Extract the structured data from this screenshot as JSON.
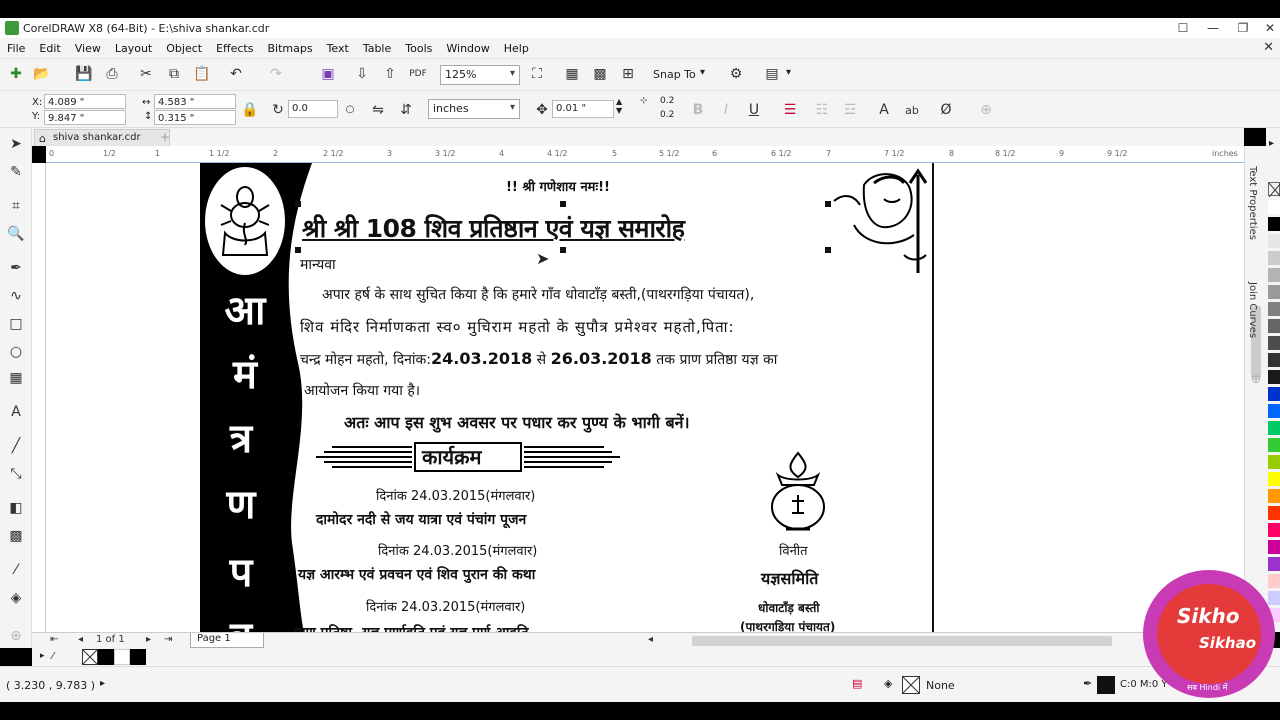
{
  "window": {
    "title": "CorelDRAW X8 (64-Bit) - E:\\shiva shankar.cdr",
    "controls": [
      "☐",
      "—",
      "❐",
      "✕"
    ]
  },
  "menu": [
    "File",
    "Edit",
    "View",
    "Layout",
    "Object",
    "Effects",
    "Bitmaps",
    "Text",
    "Table",
    "Tools",
    "Window",
    "Help"
  ],
  "toolbar": {
    "zoom": "125%",
    "snap_to": "Snap To"
  },
  "property_bar": {
    "x": "4.089 \"",
    "y": "9.847 \"",
    "width": "4.583 \"",
    "height": "0.315 \"",
    "rotation": "0.0",
    "units": "inches",
    "nudge": "0.01 \"",
    "dup_x": "0.2",
    "dup_y": "0.2",
    "bold": "B",
    "italic": "I",
    "underline": "U",
    "text_ab": "ab"
  },
  "tabs": {
    "document": "shiva shankar.cdr",
    "plus": "+"
  },
  "ruler": {
    "ticks": [
      "0",
      "1/2",
      "1",
      "1 1/2",
      "2",
      "2 1/2",
      "3",
      "3 1/2",
      "4",
      "4 1/2",
      "5",
      "5 1/2",
      "6",
      "6 1/2",
      "7",
      "7 1/2",
      "8",
      "8 1/2",
      "9",
      "9 1/2"
    ],
    "unit": "inches"
  },
  "dockers": {
    "text_properties": "Text Properties",
    "join_curves": "Join Curves"
  },
  "document": {
    "vertical_title": [
      "आ",
      "मं",
      "त्र",
      "ण",
      "प",
      "त्र"
    ],
    "top_line": "!! श्री गणेशाय नमः!!",
    "heading": "श्री श्री 108 शिव प्रतिष्ठान एवं यज्ञ समारोह",
    "salutation": "मान्यवा",
    "para_line1": "अपार हर्ष के साथ सुचित किया है कि हमारे गाँव धोवाटाँड़ बस्ती,(पाथरगड़िया पंचायत),",
    "para_line2": "शिव मंदिर निर्माणकता स्व० मुचिराम महतो के सुपौत्र प्रमेश्वर महतो,पिता:",
    "para_line3_a": "चन्द्र मोहन महतो, दिनांक:",
    "para_line3_date1": "24.03.2018",
    "para_line3_b": " से ",
    "para_line3_date2": "26.03.2018",
    "para_line3_c": " तक प्राण प्रतिष्ठा यज्ञ का",
    "para_line4": "आयोजन किया गया है।",
    "invite_line": "अतः आप इस शुभ अवसर पर पधार कर पुण्य के भागी बनें।",
    "program_title": "कार्यक्रम",
    "program": [
      {
        "date": "दिनांक 24.03.2015(मंगलवार)",
        "event": "दामोदर नदी से जय यात्रा एवं पंचांग पूजन"
      },
      {
        "date": "दिनांक 24.03.2015(मंगलवार)",
        "event": "यज्ञ आरम्भ एवं प्रवचन एवं शिव पुरान की कथा"
      },
      {
        "date": "दिनांक 24.03.2015(मंगलवार)",
        "event": "प्राण प्रतिष्ठा, यज्ञ पूर्णाहुति एवं यज्ञ पूर्ण आहुति"
      }
    ],
    "vinit": "विनीत",
    "committee": "यज्ञसमिति",
    "place1": "धोवाटाँड़ बस्ती",
    "place2": "(पाथरगड़िया पंचायत)"
  },
  "pagenav": {
    "page_of": "1 of 1",
    "page_tab": "Page 1"
  },
  "status": {
    "coords": "( 3.230 , 9.783 )",
    "fill": "None",
    "color": "C:0 M:0 Y"
  },
  "watermark": {
    "line1": "Sikho",
    "line2": "Sikhao",
    "line3": "सब Hindi में"
  },
  "palette_colors": [
    "#ffffff",
    "#000000",
    "#e6e6e6",
    "#cccccc",
    "#b3b3b3",
    "#999999",
    "#808080",
    "#666666",
    "#4d4d4d",
    "#333333",
    "#1a1a1a",
    "#0033cc",
    "#0066ff",
    "#00cc66",
    "#33cc33",
    "#99cc00",
    "#ffff00",
    "#ff9900",
    "#ff3300",
    "#ff0066",
    "#cc0099",
    "#9933cc",
    "#ffcccc",
    "#ccccff",
    "#ffccff"
  ]
}
